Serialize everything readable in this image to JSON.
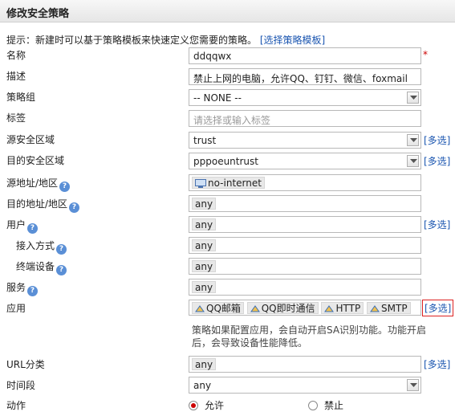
{
  "title": "修改安全策略",
  "hint": {
    "text": "提示：新建时可以基于策略模板来快速定义您需要的策略。",
    "link": "[选择策略模板]"
  },
  "fields": {
    "name": {
      "label": "名称",
      "value": "ddqqwx",
      "required_mark": "*"
    },
    "description": {
      "label": "描述",
      "value": "禁止上网的电脑，允许QQ、钉钉、微信、foxmail"
    },
    "policy_group": {
      "label": "策略组",
      "value": "-- NONE --"
    },
    "tag": {
      "label": "标签",
      "placeholder": "请选择或输入标签"
    },
    "src_zone": {
      "label": "源安全区域",
      "value": "trust",
      "multi": "[多选]"
    },
    "dst_zone": {
      "label": "目的安全区域",
      "value": "pppoeuntrust",
      "multi": "[多选]"
    },
    "src_addr": {
      "label": "源地址/地区",
      "value": "no-internet"
    },
    "dst_addr": {
      "label": "目的地址/地区",
      "value": "any"
    },
    "user": {
      "label": "用户",
      "value": "any",
      "multi": "[多选]"
    },
    "access_mode": {
      "label": "接入方式",
      "value": "any"
    },
    "terminal": {
      "label": "终端设备",
      "value": "any"
    },
    "service": {
      "label": "服务",
      "value": "any"
    },
    "application": {
      "label": "应用",
      "items": [
        "QQ邮箱",
        "QQ即时通信",
        "HTTP",
        "SMTP"
      ],
      "multi": "[多选]"
    },
    "app_note": "策略如果配置应用，会自动开启SA识别功能。功能开启后，会导致设备性能降低。",
    "url_category": {
      "label": "URL分类",
      "value": "any",
      "multi": "[多选]"
    },
    "time_range": {
      "label": "时间段",
      "value": "any"
    },
    "action": {
      "label": "动作",
      "options": [
        "允许",
        "禁止"
      ],
      "selected": "允许"
    }
  },
  "help_glyph": "?",
  "colors": {
    "link": "#1a55b0",
    "required": "#cc0000",
    "highlight_border": "#dd2222",
    "radio_selected": "#cc0000"
  }
}
